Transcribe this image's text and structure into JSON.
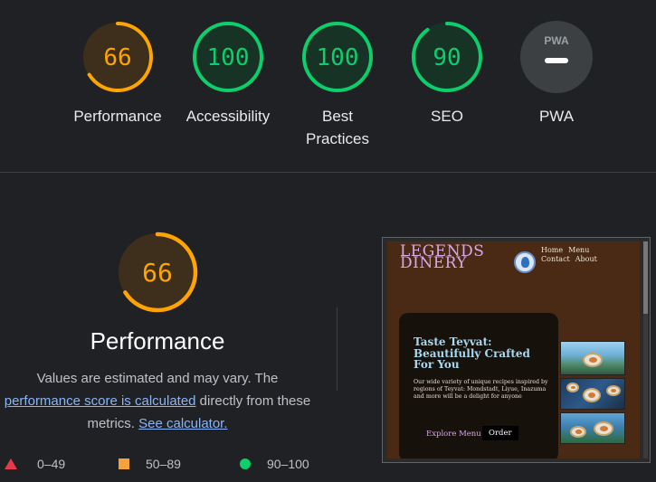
{
  "gauges": [
    {
      "score": "66",
      "label": "Performance",
      "fraction": 0.66,
      "color": "#ffa400",
      "bg": "#3d2f1c"
    },
    {
      "score": "100",
      "label": "Accessibility",
      "fraction": 1.0,
      "color": "#0cce6b",
      "bg": "#173326"
    },
    {
      "score": "100",
      "label_line1": "Best",
      "label_line2": "Practices",
      "fraction": 1.0,
      "color": "#0cce6b",
      "bg": "#173326"
    },
    {
      "score": "90",
      "label": "SEO",
      "fraction": 0.9,
      "color": "#0cce6b",
      "bg": "#173326"
    },
    {
      "score": "PWA",
      "label": "PWA",
      "color": "#9aa0a6",
      "bg": "#3c4043"
    }
  ],
  "performance": {
    "score": "66",
    "fraction": 0.66,
    "title": "Performance",
    "desc_part1": "Values are estimated and may vary. The ",
    "link1": "performance score is calculated",
    "desc_part2": " directly from these metrics. ",
    "link2": "See calculator."
  },
  "legend": {
    "fail": "0–49",
    "average": "50–89",
    "pass": "90–100"
  },
  "colors": {
    "fail": "#e8394a",
    "average": "#ffa400",
    "pass": "#0cce6b"
  },
  "screenshot": {
    "logo_line1": "LEGENDS",
    "logo_line2": "DINERY",
    "nav": [
      "Home",
      "Menu",
      "Contact",
      "About"
    ],
    "hero_title": "Taste Teyvat: Beautifully Crafted For You",
    "hero_body": "Our wide variety of unique recipes inspired by regions of Teyvat: Mondstadt, Liyue, Inazuma and more will be a delight for anyone",
    "explore": "Explore Menu",
    "order": "Order"
  }
}
